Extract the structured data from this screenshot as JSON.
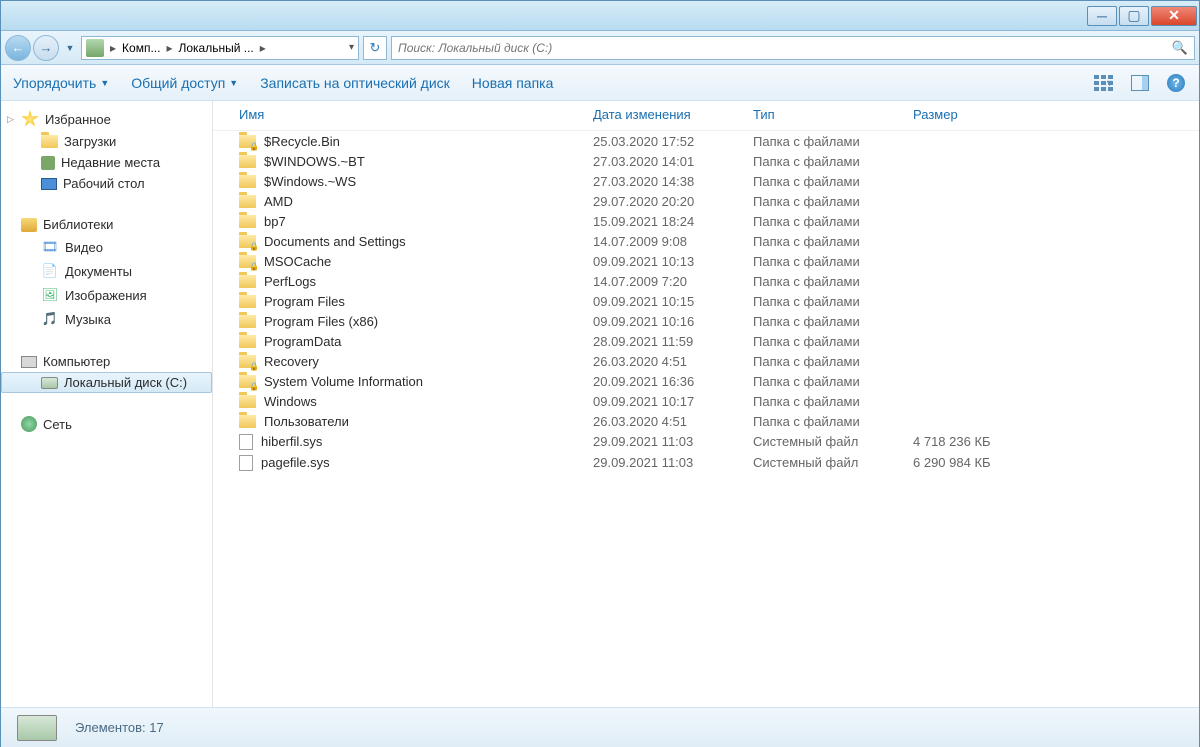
{
  "breadcrumb": {
    "seg1": "Комп...",
    "seg2": "Локальный ...",
    "sep": "▸"
  },
  "search": {
    "placeholder": "Поиск: Локальный диск (C:)"
  },
  "toolbar": {
    "organize": "Упорядочить",
    "share": "Общий доступ",
    "burn": "Записать на оптический диск",
    "newfolder": "Новая папка"
  },
  "sidebar": {
    "favorites": {
      "head": "Избранное",
      "downloads": "Загрузки",
      "recent": "Недавние места",
      "desktop": "Рабочий стол"
    },
    "libraries": {
      "head": "Библиотеки",
      "video": "Видео",
      "documents": "Документы",
      "images": "Изображения",
      "music": "Музыка"
    },
    "computer": {
      "head": "Компьютер",
      "drive_c": "Локальный диск (C:)"
    },
    "network": {
      "head": "Сеть"
    }
  },
  "columns": {
    "name": "Имя",
    "date": "Дата изменения",
    "type": "Тип",
    "size": "Размер"
  },
  "items": [
    {
      "name": "$Recycle.Bin",
      "date": "25.03.2020 17:52",
      "type": "Папка с файлами",
      "size": "",
      "icon": "folder-lock"
    },
    {
      "name": "$WINDOWS.~BT",
      "date": "27.03.2020 14:01",
      "type": "Папка с файлами",
      "size": "",
      "icon": "folder"
    },
    {
      "name": "$Windows.~WS",
      "date": "27.03.2020 14:38",
      "type": "Папка с файлами",
      "size": "",
      "icon": "folder"
    },
    {
      "name": "AMD",
      "date": "29.07.2020 20:20",
      "type": "Папка с файлами",
      "size": "",
      "icon": "folder"
    },
    {
      "name": "bp7",
      "date": "15.09.2021 18:24",
      "type": "Папка с файлами",
      "size": "",
      "icon": "folder"
    },
    {
      "name": "Documents and Settings",
      "date": "14.07.2009 9:08",
      "type": "Папка с файлами",
      "size": "",
      "icon": "folder-lock"
    },
    {
      "name": "MSOCache",
      "date": "09.09.2021 10:13",
      "type": "Папка с файлами",
      "size": "",
      "icon": "folder-lock"
    },
    {
      "name": "PerfLogs",
      "date": "14.07.2009 7:20",
      "type": "Папка с файлами",
      "size": "",
      "icon": "folder"
    },
    {
      "name": "Program Files",
      "date": "09.09.2021 10:15",
      "type": "Папка с файлами",
      "size": "",
      "icon": "folder"
    },
    {
      "name": "Program Files (x86)",
      "date": "09.09.2021 10:16",
      "type": "Папка с файлами",
      "size": "",
      "icon": "folder"
    },
    {
      "name": "ProgramData",
      "date": "28.09.2021 11:59",
      "type": "Папка с файлами",
      "size": "",
      "icon": "folder"
    },
    {
      "name": "Recovery",
      "date": "26.03.2020 4:51",
      "type": "Папка с файлами",
      "size": "",
      "icon": "folder-lock"
    },
    {
      "name": "System Volume Information",
      "date": "20.09.2021 16:36",
      "type": "Папка с файлами",
      "size": "",
      "icon": "folder-lock"
    },
    {
      "name": "Windows",
      "date": "09.09.2021 10:17",
      "type": "Папка с файлами",
      "size": "",
      "icon": "folder"
    },
    {
      "name": "Пользователи",
      "date": "26.03.2020 4:51",
      "type": "Папка с файлами",
      "size": "",
      "icon": "folder"
    },
    {
      "name": "hiberfil.sys",
      "date": "29.09.2021 11:03",
      "type": "Системный файл",
      "size": "4 718 236 КБ",
      "icon": "file"
    },
    {
      "name": "pagefile.sys",
      "date": "29.09.2021 11:03",
      "type": "Системный файл",
      "size": "6 290 984 КБ",
      "icon": "file"
    }
  ],
  "status": {
    "count_label": "Элементов: 17"
  }
}
